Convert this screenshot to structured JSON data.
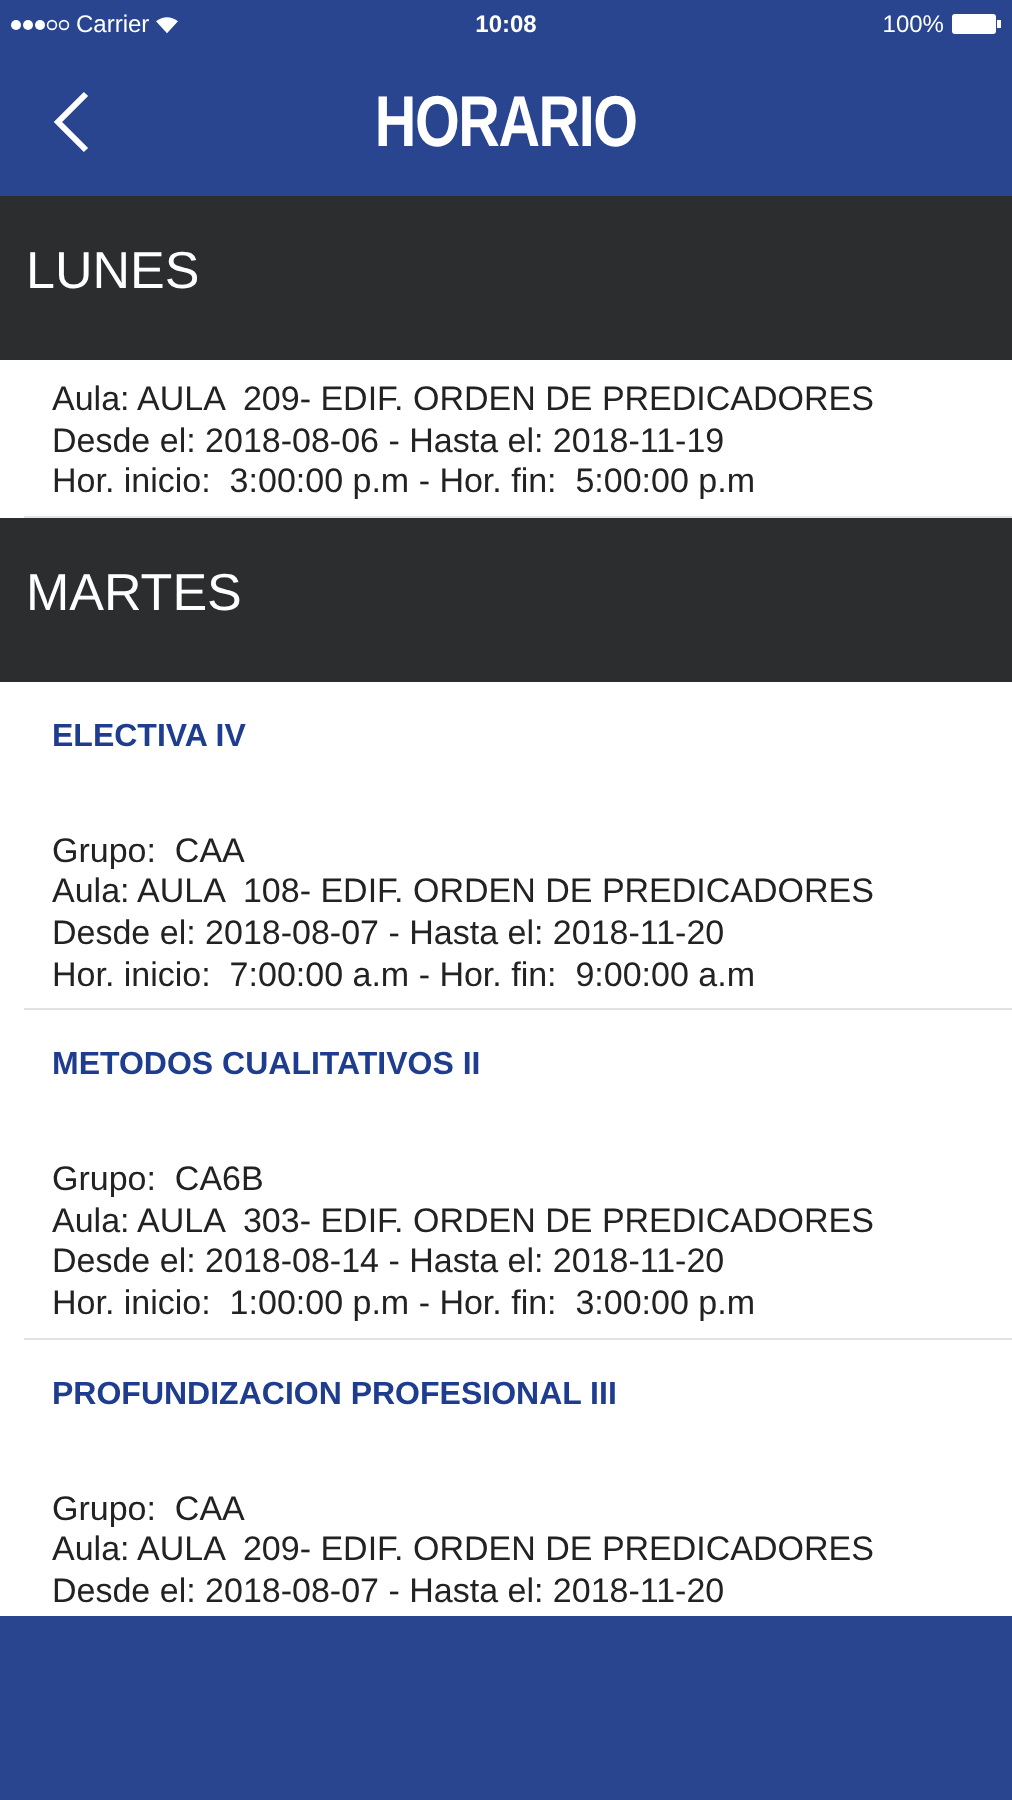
{
  "status_bar": {
    "carrier": "Carrier",
    "time": "10:08",
    "battery": "100%"
  },
  "nav": {
    "title": "HORARIO"
  },
  "days": [
    {
      "name": "LUNES",
      "courses": [
        {
          "lines": [
            "Aula: AULA  209- EDIF. ORDEN DE PREDICADORES",
            "Desde el: 2018-08-06 - Hasta el: 2018-11-19",
            "Hor. inicio:  3:00:00 p.m - Hor. fin:  5:00:00 p.m"
          ]
        }
      ]
    },
    {
      "name": "MARTES",
      "courses": [
        {
          "title": "ELECTIVA IV",
          "lines": [
            "Grupo:  CAA",
            "Aula: AULA  108- EDIF. ORDEN DE PREDICADORES",
            "Desde el: 2018-08-07 - Hasta el: 2018-11-20",
            "Hor. inicio:  7:00:00 a.m - Hor. fin:  9:00:00 a.m"
          ]
        },
        {
          "title": "METODOS CUALITATIVOS II",
          "lines": [
            "Grupo:  CA6B",
            "Aula: AULA  303- EDIF. ORDEN DE PREDICADORES",
            "Desde el: 2018-08-14 - Hasta el: 2018-11-20",
            "Hor. inicio:  1:00:00 p.m - Hor. fin:  3:00:00 p.m"
          ]
        },
        {
          "title": "PROFUNDIZACION PROFESIONAL III",
          "lines": [
            "Grupo:  CAA",
            "Aula: AULA  209- EDIF. ORDEN DE PREDICADORES",
            "Desde el: 2018-08-07 - Hasta el: 2018-11-20"
          ]
        }
      ]
    }
  ]
}
